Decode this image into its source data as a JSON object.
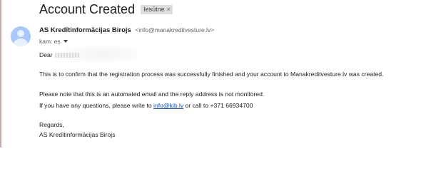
{
  "email": {
    "subject": "Account Created",
    "label": {
      "text": "Iesūtne",
      "close_glyph": "×"
    },
    "sender": {
      "name": "AS Kredītinformācijas Birojs",
      "email": "<info@manakreditvesture.lv>"
    },
    "recipient_line": "kam: es",
    "body": {
      "greeting": "Dear",
      "confirmation": "This is to confirm that the registration process was successfully finished and your account to Manakreditvesture.lv was created.",
      "notice": "Please note that this is an automated email and the reply address is not monitored.",
      "contact_prefix": "If you have any questions, please write to",
      "contact_email": "info@kib.lv",
      "contact_suffix": "or call to +371 66934700",
      "closing": "Regards,",
      "signature": "AS Kredītinformācijas Birojs"
    }
  },
  "colors": {
    "link": "#1155cc",
    "avatar": "#a8c7fa",
    "chip_bg": "#dddddd"
  }
}
